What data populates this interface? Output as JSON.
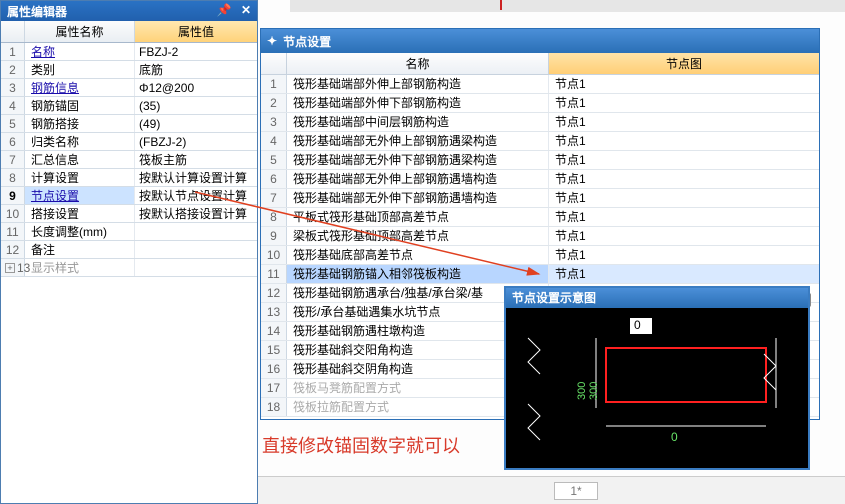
{
  "prop_editor": {
    "title": "属性编辑器",
    "col_name": "属性名称",
    "col_value": "属性值",
    "rows": [
      {
        "n": "1",
        "name": "名称",
        "value": "FBZJ-2",
        "link": true
      },
      {
        "n": "2",
        "name": "类别",
        "value": "底筋"
      },
      {
        "n": "3",
        "name": "钢筋信息",
        "value": "Φ12@200",
        "link": true
      },
      {
        "n": "4",
        "name": "钢筋锚固",
        "value": "(35)"
      },
      {
        "n": "5",
        "name": "钢筋搭接",
        "value": "(49)"
      },
      {
        "n": "6",
        "name": "归类名称",
        "value": "(FBZJ-2)"
      },
      {
        "n": "7",
        "name": "汇总信息",
        "value": "筏板主筋"
      },
      {
        "n": "8",
        "name": "计算设置",
        "value": "按默认计算设置计算"
      },
      {
        "n": "9",
        "name": "节点设置",
        "value": "按默认节点设置计算",
        "hl": true,
        "link": true
      },
      {
        "n": "10",
        "name": "搭接设置",
        "value": "按默认搭接设置计算"
      },
      {
        "n": "11",
        "name": "长度调整(mm)",
        "value": ""
      },
      {
        "n": "12",
        "name": "备注",
        "value": ""
      },
      {
        "n": "13",
        "name": "显示样式",
        "value": "",
        "style": true
      }
    ]
  },
  "node_win": {
    "title": "节点设置",
    "col_name": "名称",
    "col_diag": "节点图",
    "rows": [
      {
        "n": "1",
        "name": "筏形基础端部外伸上部钢筋构造",
        "diag": "节点1"
      },
      {
        "n": "2",
        "name": "筏形基础端部外伸下部钢筋构造",
        "diag": "节点1"
      },
      {
        "n": "3",
        "name": "筏形基础端部中间层钢筋构造",
        "diag": "节点1"
      },
      {
        "n": "4",
        "name": "筏形基础端部无外伸上部钢筋遇梁构造",
        "diag": "节点1"
      },
      {
        "n": "5",
        "name": "筏形基础端部无外伸下部钢筋遇梁构造",
        "diag": "节点1"
      },
      {
        "n": "6",
        "name": "筏形基础端部无外伸上部钢筋遇墙构造",
        "diag": "节点1"
      },
      {
        "n": "7",
        "name": "筏形基础端部无外伸下部钢筋遇墙构造",
        "diag": "节点1"
      },
      {
        "n": "8",
        "name": "平板式筏形基础顶部高差节点",
        "diag": "节点1"
      },
      {
        "n": "9",
        "name": "梁板式筏形基础顶部高差节点",
        "diag": "节点1"
      },
      {
        "n": "10",
        "name": "筏形基础底部高差节点",
        "diag": "节点1"
      },
      {
        "n": "11",
        "name": "筏形基础钢筋锚入相邻筏板构造",
        "diag": "节点1",
        "sel": true
      },
      {
        "n": "12",
        "name": "筏形基础钢筋遇承台/独基/承台梁/基",
        "diag": ""
      },
      {
        "n": "13",
        "name": "筏形/承台基础遇集水坑节点",
        "diag": ""
      },
      {
        "n": "14",
        "name": "筏形基础钢筋遇柱墩构造",
        "diag": ""
      },
      {
        "n": "15",
        "name": "筏形基础斜交阳角构造",
        "diag": ""
      },
      {
        "n": "16",
        "name": "筏形基础斜交阴角构造",
        "diag": ""
      },
      {
        "n": "17",
        "name": "筏板马凳筋配置方式",
        "diag": "",
        "dim": true
      },
      {
        "n": "18",
        "name": "筏板拉筋配置方式",
        "diag": "",
        "dim": true
      }
    ]
  },
  "diagram": {
    "title": "节点设置示意图",
    "label_top": "0",
    "label_bottom": "0",
    "label_v1": "300",
    "label_v2": "300"
  },
  "annotation": "直接修改锚固数字就可以",
  "bottom_cell": "1*",
  "expand_btn": "..."
}
